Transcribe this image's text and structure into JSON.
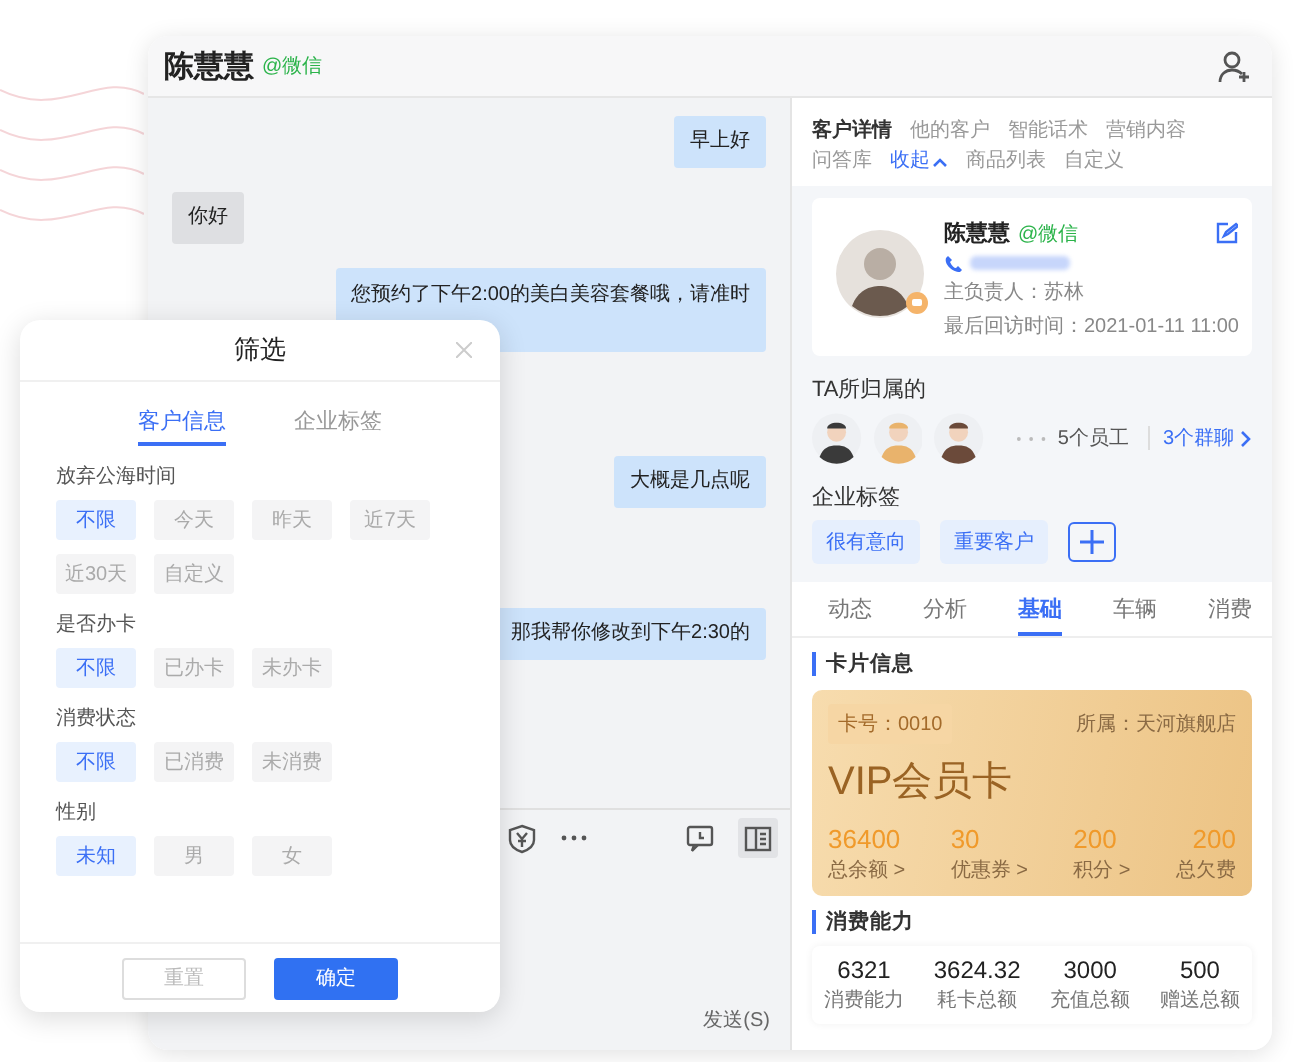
{
  "chat": {
    "contact_name": "陈慧慧",
    "contact_source": "@微信",
    "messages": [
      {
        "kind": "outgoing",
        "text": "早上好"
      },
      {
        "kind": "incoming",
        "text": "你好"
      },
      {
        "kind": "outgoing",
        "text": "您预约了下午2:00的美白美容套餐哦，请准时"
      },
      {
        "kind": "outgoing",
        "text": "大概是几点呢"
      },
      {
        "kind": "outgoing",
        "text": "那我帮你修改到下午2:30的"
      }
    ],
    "send_button": "发送(S)"
  },
  "customer_panel": {
    "tabs": [
      {
        "label": "客户详情",
        "selected": true
      },
      {
        "label": "他的客户",
        "selected": false
      },
      {
        "label": "智能话术",
        "selected": false
      },
      {
        "label": "营销内容",
        "selected": false
      },
      {
        "label": "问答库",
        "selected": false
      },
      {
        "label": "商品列表",
        "selected": false
      },
      {
        "label": "自定义",
        "selected": false
      }
    ],
    "collapse_link": "收起",
    "profile": {
      "name": "陈慧慧",
      "source": "@微信",
      "owner": "主负责人：苏林",
      "last_visit": "最后回访时间：2021-01-11 11:00"
    },
    "belongs": {
      "title": "TA所归属的",
      "employees": "5个员工",
      "groups": "3个群聊"
    },
    "tags": {
      "title": "企业标签",
      "items": [
        "很有意向",
        "重要客户"
      ]
    },
    "section_tabs": [
      {
        "label": "动态",
        "selected": false
      },
      {
        "label": "分析",
        "selected": false
      },
      {
        "label": "基础",
        "selected": true
      },
      {
        "label": "车辆",
        "selected": false
      },
      {
        "label": "消费",
        "selected": false
      }
    ],
    "card_info": {
      "title": "卡片信息",
      "card_no": "卡号：0010",
      "store": "所属：天河旗舰店",
      "card_name": "VIP会员卡",
      "stats": [
        {
          "value": "36400",
          "label": "总余额 >"
        },
        {
          "value": "30",
          "label": "优惠券 >"
        },
        {
          "value": "200",
          "label": "积分 >"
        },
        {
          "value": "200",
          "label": "总欠费"
        }
      ]
    },
    "consumption": {
      "title": "消费能力",
      "stats": [
        {
          "value": "6321",
          "label": "消费能力"
        },
        {
          "value": "3624.32",
          "label": "耗卡总额"
        },
        {
          "value": "3000",
          "label": "充值总额"
        },
        {
          "value": "500",
          "label": "赠送总额"
        }
      ]
    }
  },
  "filter": {
    "title": "筛选",
    "tabs": [
      {
        "label": "客户信息",
        "selected": true
      },
      {
        "label": "企业标签",
        "selected": false
      }
    ],
    "groups": [
      {
        "label": "放弃公海时间",
        "options": [
          {
            "label": "不限",
            "selected": true
          },
          {
            "label": "今天",
            "selected": false
          },
          {
            "label": "昨天",
            "selected": false
          },
          {
            "label": "近7天",
            "selected": false
          },
          {
            "label": "近30天",
            "selected": false
          },
          {
            "label": "自定义",
            "selected": false
          }
        ]
      },
      {
        "label": "是否办卡",
        "options": [
          {
            "label": "不限",
            "selected": true
          },
          {
            "label": "已办卡",
            "selected": false
          },
          {
            "label": "未办卡",
            "selected": false
          }
        ]
      },
      {
        "label": "消费状态",
        "options": [
          {
            "label": "不限",
            "selected": true
          },
          {
            "label": "已消费",
            "selected": false
          },
          {
            "label": "未消费",
            "selected": false
          }
        ]
      },
      {
        "label": "性别",
        "options": [
          {
            "label": "未知",
            "selected": true
          },
          {
            "label": "男",
            "selected": false
          },
          {
            "label": "女",
            "selected": false
          }
        ]
      }
    ],
    "reset_button": "重置",
    "confirm_button": "确定"
  }
}
